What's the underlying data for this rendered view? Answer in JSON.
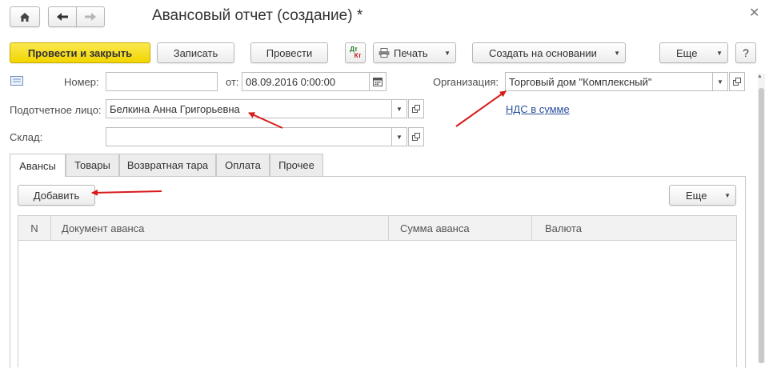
{
  "window": {
    "title": "Авансовый отчет (создание) *"
  },
  "toolbar": {
    "post_close_label": "Провести и закрыть",
    "save_label": "Записать",
    "post_label": "Провести",
    "dt_label": "Дт",
    "kt_label": "Кт",
    "print_label": "Печать",
    "create_based_label": "Создать на основании",
    "more_label": "Еще",
    "help_label": "?"
  },
  "form": {
    "number_label": "Номер:",
    "number_value": "",
    "date_from_label": "от:",
    "date_value": "08.09.2016  0:00:00",
    "organization_label": "Организация:",
    "organization_value": "Торговый дом \"Комплексный\"",
    "accountable_label": "Подотчетное лицо:",
    "accountable_value": "Белкина Анна  Григорьевна",
    "vat_link": "НДС в сумме",
    "warehouse_label": "Склад:",
    "warehouse_value": ""
  },
  "tabs": [
    {
      "label": "Авансы",
      "active": true
    },
    {
      "label": "Товары",
      "active": false
    },
    {
      "label": "Возвратная тара",
      "active": false
    },
    {
      "label": "Оплата",
      "active": false
    },
    {
      "label": "Прочее",
      "active": false
    }
  ],
  "table": {
    "add_label": "Добавить",
    "more_label": "Еще",
    "columns": [
      "N",
      "Документ аванса",
      "Сумма аванса",
      "Валюта"
    ],
    "rows": []
  },
  "colors": {
    "primary_button": "#f2d500",
    "annotation_arrow": "#d91a1a",
    "link": "#2a4f9e"
  },
  "icons": [
    "home-icon",
    "back-arrow-icon",
    "forward-arrow-icon",
    "close-icon",
    "printer-icon",
    "calendar-icon",
    "open-icon",
    "dropdown-icon",
    "notes-icon"
  ]
}
